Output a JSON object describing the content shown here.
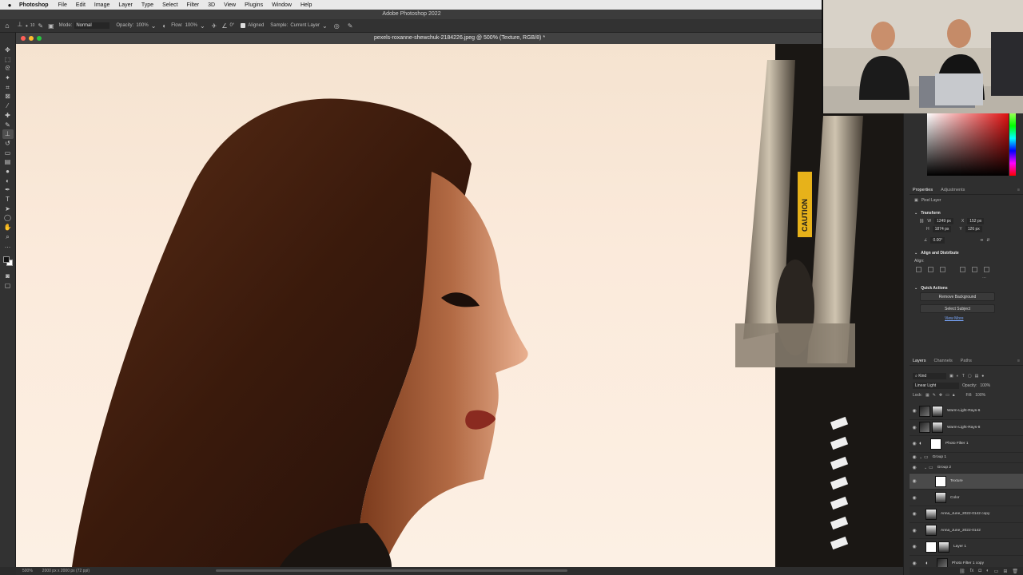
{
  "menubar": {
    "apple": "",
    "app_name": "Photoshop",
    "items": [
      "File",
      "Edit",
      "Image",
      "Layer",
      "Type",
      "Select",
      "Filter",
      "3D",
      "View",
      "Plugins",
      "Window",
      "Help"
    ]
  },
  "window_title": "Adobe Photoshop 2022",
  "options_bar": {
    "mode_label": "Mode:",
    "mode_value": "Normal",
    "opacity_label": "Opacity:",
    "opacity_value": "100%",
    "flow_label": "Flow:",
    "flow_value": "100%",
    "angle_value": "0°",
    "aligned_label": "Aligned",
    "sample_label": "Sample:",
    "sample_value": "Current Layer",
    "brush_size": "10"
  },
  "document": {
    "tab_title": "pexels-roxanne-shewchuk-2184226.jpeg @ 500% (Texture, RGB/8) *"
  },
  "status_bar": {
    "zoom": "500%",
    "doc_size": "2000 px x 2000 px (72 ppi)"
  },
  "properties": {
    "tabs": [
      "Properties",
      "Adjustments"
    ],
    "layer_type": "Pixel Layer",
    "transform_title": "Transform",
    "w": "1249 px",
    "h": "1874 px",
    "x": "152 px",
    "y": "126 px",
    "angle": "0.00°",
    "align_title": "Align and Distribute",
    "align_label": "Align:",
    "quick_actions_title": "Quick Actions",
    "remove_bg": "Remove Background",
    "select_subject": "Select Subject",
    "view_more": "View More"
  },
  "layers_panel": {
    "tabs": [
      "Layers",
      "Channels",
      "Paths"
    ],
    "kind": "Kind",
    "blend_mode": "Linear Light",
    "opacity_label": "Opacity:",
    "opacity_value": "100%",
    "lock_label": "Lock:",
    "fill_label": "Fill:",
    "fill_value": "100%",
    "layers": [
      {
        "name": "Warm-Light-Rays-6",
        "kind": "photo"
      },
      {
        "name": "Warm-Light-Rays-8",
        "kind": "photo"
      },
      {
        "name": "Photo Filter 1",
        "kind": "adjust"
      },
      {
        "name": "Group 1",
        "kind": "group"
      },
      {
        "name": "Group 2",
        "kind": "group"
      },
      {
        "name": "Texture",
        "kind": "pixel"
      },
      {
        "name": "Color",
        "kind": "pixel"
      },
      {
        "name": "Anna_June_2022-0142 copy",
        "kind": "photo"
      },
      {
        "name": "Anna_June_2022-0142",
        "kind": "photo"
      },
      {
        "name": "Layer 1",
        "kind": "pixel"
      },
      {
        "name": "Photo Filter 1 copy",
        "kind": "adjust"
      }
    ]
  },
  "canvas_sign": "CAUTION"
}
